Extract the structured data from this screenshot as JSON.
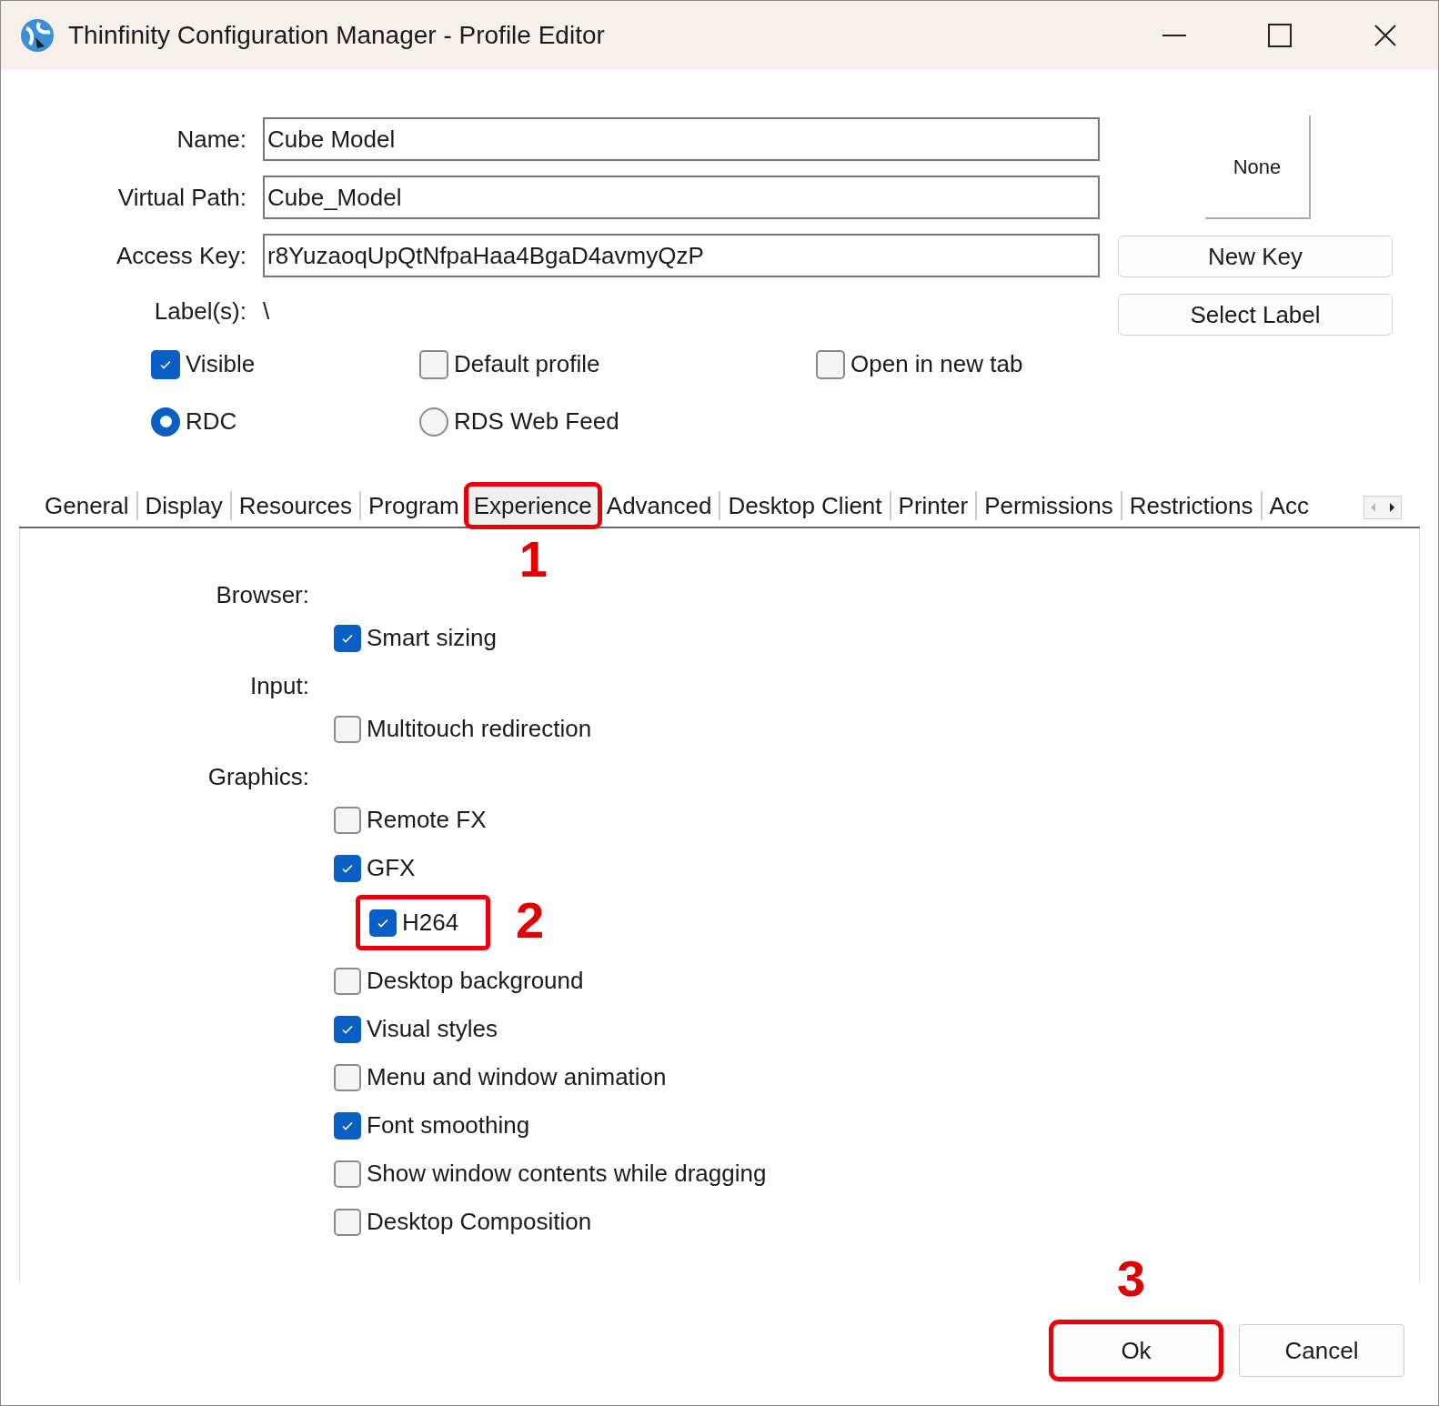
{
  "window": {
    "title": "Thinfinity Configuration Manager - Profile Editor"
  },
  "fields": [
    {
      "label": "Name:",
      "value": "Cube Model"
    },
    {
      "label": "Virtual Path:",
      "value": "Cube_Model"
    },
    {
      "label": "Access Key:",
      "value": "r8YuzaoqUpQtNfpaHaa4BgaD4avmyQzP"
    }
  ],
  "labels_row": {
    "label": "Label(s):",
    "value": "\\"
  },
  "icon_box": {
    "text": "None"
  },
  "side_buttons": [
    "New Key",
    "Select Label"
  ],
  "options": [
    {
      "kind": "checkbox",
      "label": "Visible",
      "checked": true
    },
    {
      "kind": "checkbox",
      "label": "Default profile",
      "checked": false
    },
    {
      "kind": "checkbox",
      "label": "Open in new tab",
      "checked": false
    },
    {
      "kind": "radio",
      "label": "RDC",
      "selected": true
    },
    {
      "kind": "radio",
      "label": "RDS Web Feed",
      "selected": false
    }
  ],
  "tabs": [
    {
      "label": "General",
      "selected": false
    },
    {
      "label": "Display",
      "selected": false
    },
    {
      "label": "Resources",
      "selected": false
    },
    {
      "label": "Program",
      "selected": false
    },
    {
      "label": "Experience",
      "selected": true,
      "callout": "1"
    },
    {
      "label": "Advanced",
      "selected": false
    },
    {
      "label": "Desktop Client",
      "selected": false
    },
    {
      "label": "Printer",
      "selected": false
    },
    {
      "label": "Permissions",
      "selected": false
    },
    {
      "label": "Restrictions",
      "selected": false
    },
    {
      "label": "Acc",
      "selected": false
    }
  ],
  "groups": [
    {
      "label": "Browser:",
      "items": [
        {
          "label": "Smart sizing",
          "checked": true
        }
      ]
    },
    {
      "label": "Input:",
      "items": [
        {
          "label": "Multitouch redirection",
          "checked": false
        }
      ]
    },
    {
      "label": "Graphics:",
      "items": [
        {
          "label": "Remote FX",
          "checked": false
        },
        {
          "label": "GFX",
          "checked": true,
          "children": [
            {
              "label": "H264",
              "checked": true,
              "callout": "2"
            }
          ]
        },
        {
          "label": "Desktop background",
          "checked": false
        },
        {
          "label": "Visual styles",
          "checked": true
        },
        {
          "label": "Menu and window animation",
          "checked": false
        },
        {
          "label": "Font smoothing",
          "checked": true
        },
        {
          "label": "Show window contents while dragging",
          "checked": false
        },
        {
          "label": "Desktop Composition",
          "checked": false
        }
      ]
    }
  ],
  "buttons": [
    {
      "label": "Ok",
      "callout": "3"
    },
    {
      "label": "Cancel"
    }
  ]
}
